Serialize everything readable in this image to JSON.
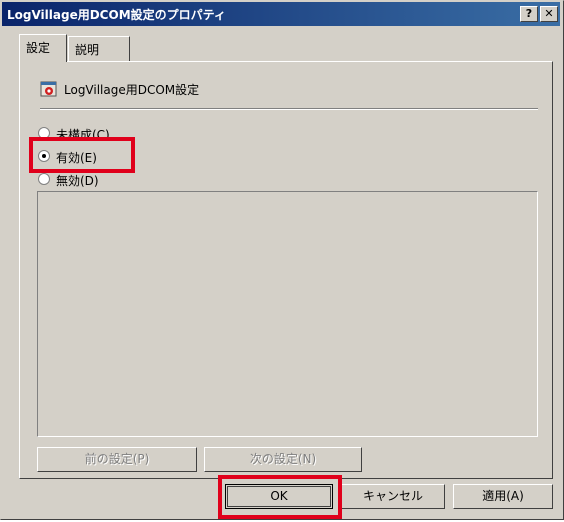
{
  "window": {
    "title": "LogVillage用DCOM設定のプロパティ",
    "help_label": "?",
    "close_label": "✕"
  },
  "tabs": [
    {
      "label": "設定",
      "selected": true
    },
    {
      "label": "説明",
      "selected": false
    }
  ],
  "policy": {
    "icon": "policy-setting-icon",
    "title": "LogVillage用DCOM設定"
  },
  "radios": [
    {
      "label": "未構成(C)",
      "checked": false
    },
    {
      "label": "有効(E)",
      "checked": true
    },
    {
      "label": "無効(D)",
      "checked": false
    }
  ],
  "nav_buttons": {
    "prev_label": "前の設定(P)",
    "next_label": "次の設定(N)"
  },
  "dialog_buttons": {
    "ok_label": "OK",
    "cancel_label": "キャンセル",
    "apply_label": "適用(A)"
  },
  "colors": {
    "title_start": "#0a246a",
    "title_end": "#3a6ea5",
    "highlight": "#e0001b",
    "face": "#d4d0c8"
  }
}
